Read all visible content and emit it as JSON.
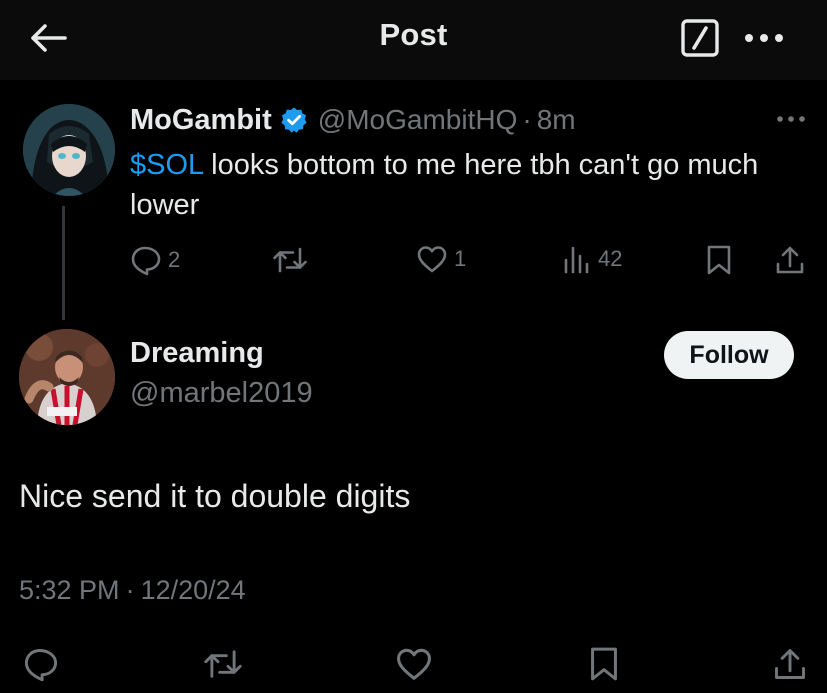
{
  "header": {
    "title": "Post",
    "back_icon": "arrow-left-icon",
    "grok_icon": "grok-icon",
    "more_icon": "more-horizontal-icon"
  },
  "quoted_post": {
    "author_name": "MoGambit",
    "verified": true,
    "verified_color": "#1d9bf0",
    "handle": "@MoGambitHQ",
    "separator": "·",
    "time": "8m",
    "text_cashtag": "$SOL",
    "text_rest": " looks bottom to me here tbh can't go much lower",
    "actions": {
      "reply_count": "2",
      "repost_count": "",
      "like_count": "1",
      "views_count": "42"
    }
  },
  "reply_post": {
    "author_name": "Dreaming",
    "handle": "@marbel2019",
    "follow_label": "Follow",
    "text": "Nice send it to double digits",
    "time": "5:32 PM",
    "separator": "·",
    "date": "12/20/24"
  },
  "bottom_actions": [
    "reply-icon",
    "repost-icon",
    "like-icon",
    "bookmark-icon",
    "share-icon"
  ],
  "colors": {
    "background": "#000000",
    "header_background": "#0b0b0b",
    "text_primary": "#e7e9ea",
    "text_secondary": "#71767b",
    "accent": "#1d9bf0"
  }
}
